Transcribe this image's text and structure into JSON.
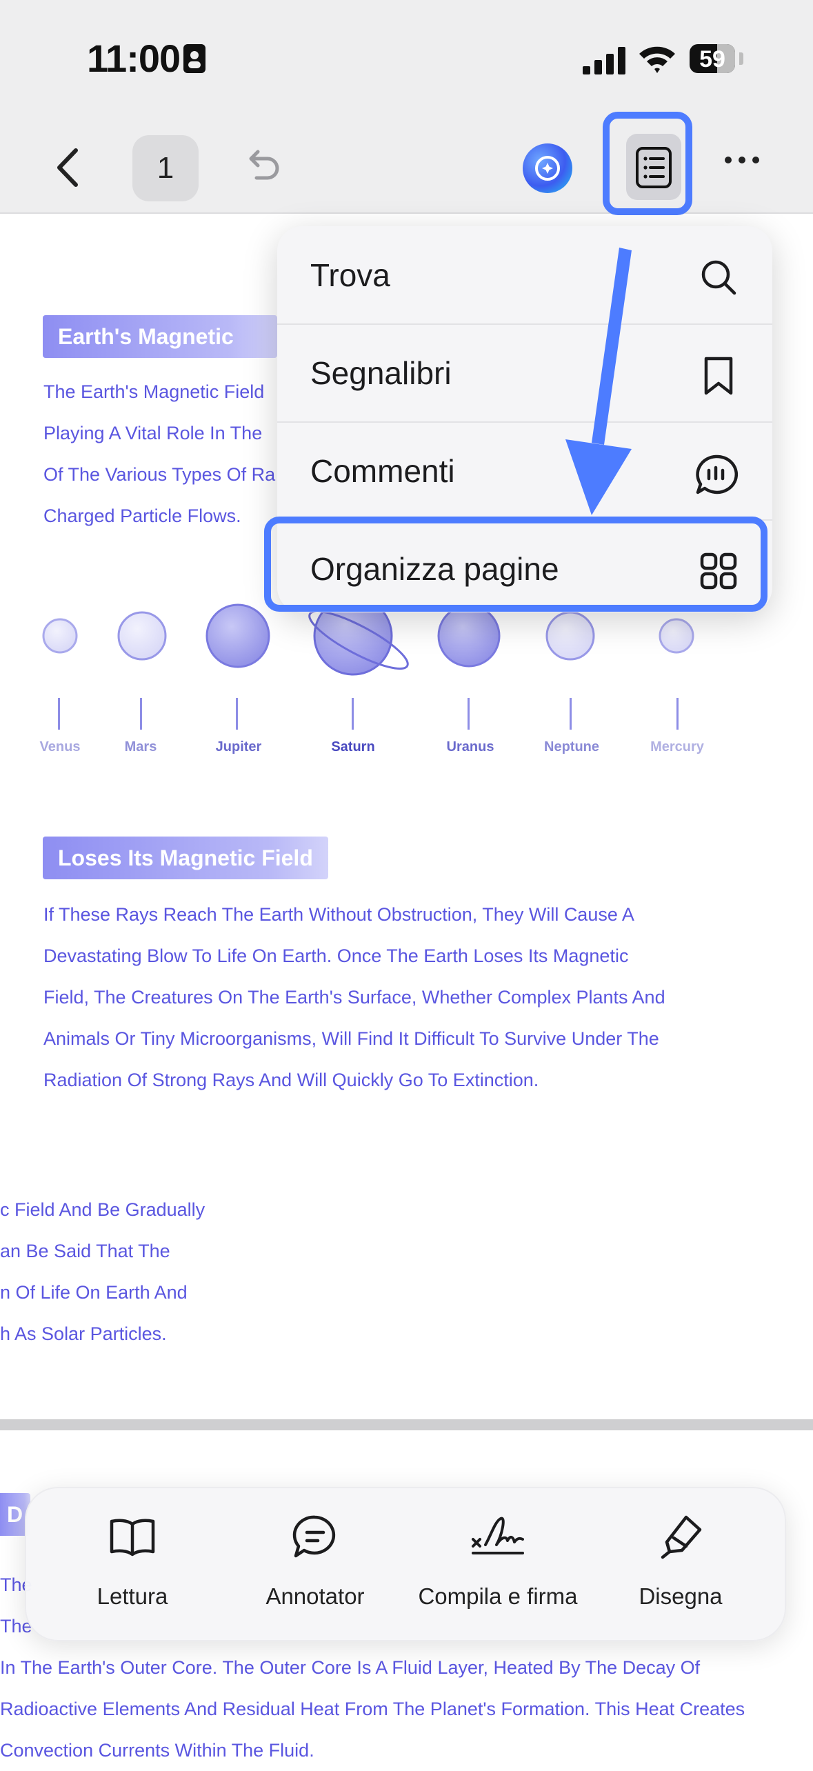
{
  "status": {
    "time": "11:00",
    "battery": "59"
  },
  "toolbar": {
    "page_number": "1"
  },
  "menu": {
    "items": [
      {
        "label": "Trova",
        "icon": "search-icon"
      },
      {
        "label": "Segnalibri",
        "icon": "bookmark-icon"
      },
      {
        "label": "Commenti",
        "icon": "comment-icon"
      },
      {
        "label": "Organizza pagine",
        "icon": "grid-icon"
      }
    ]
  },
  "document": {
    "heading1": "Earth's Magnetic",
    "para1": [
      "The Earth's Magnetic Field",
      "Playing A Vital Role In The",
      "Of The Various Types Of Ra",
      "Charged Particle Flows."
    ],
    "planets": [
      "Venus",
      "Mars",
      "Jupiter",
      "Saturn",
      "Uranus",
      "Neptune",
      "Mercury"
    ],
    "heading2": "Loses Its Magnetic Field",
    "para2": [
      "If These Rays Reach The Earth Without Obstruction, They Will Cause A",
      "Devastating Blow To Life On Earth. Once The Earth Loses Its Magnetic",
      "Field, The Creatures On The Earth's Surface, Whether Complex Plants And",
      "Animals Or Tiny Microorganisms, Will Find It Difficult To Survive Under The",
      "Radiation Of Strong Rays And Will Quickly Go To Extinction."
    ],
    "para3": [
      "c Field And Be Gradually",
      "an Be Said That The",
      "n Of Life On Earth And",
      "h As Solar Particles."
    ],
    "heading3": "D",
    "para4_partial": [
      "The",
      "The"
    ],
    "para4": [
      "In The Earth's Outer Core. The Outer Core Is A Fluid Layer, Heated By The Decay Of",
      "Radioactive Elements And Residual Heat From The Planet's Formation. This Heat Creates",
      "Convection Currents Within The Fluid."
    ]
  },
  "tabs": [
    {
      "label": "Lettura",
      "icon": "book-icon"
    },
    {
      "label": "Annotator",
      "icon": "annotate-icon"
    },
    {
      "label": "Compila e firma",
      "icon": "signature-icon"
    },
    {
      "label": "Disegna",
      "icon": "pen-icon"
    }
  ],
  "colors": {
    "accent": "#4d7cff",
    "doc_text": "#5a56e0",
    "heading_bg": "#8e8ef2"
  }
}
